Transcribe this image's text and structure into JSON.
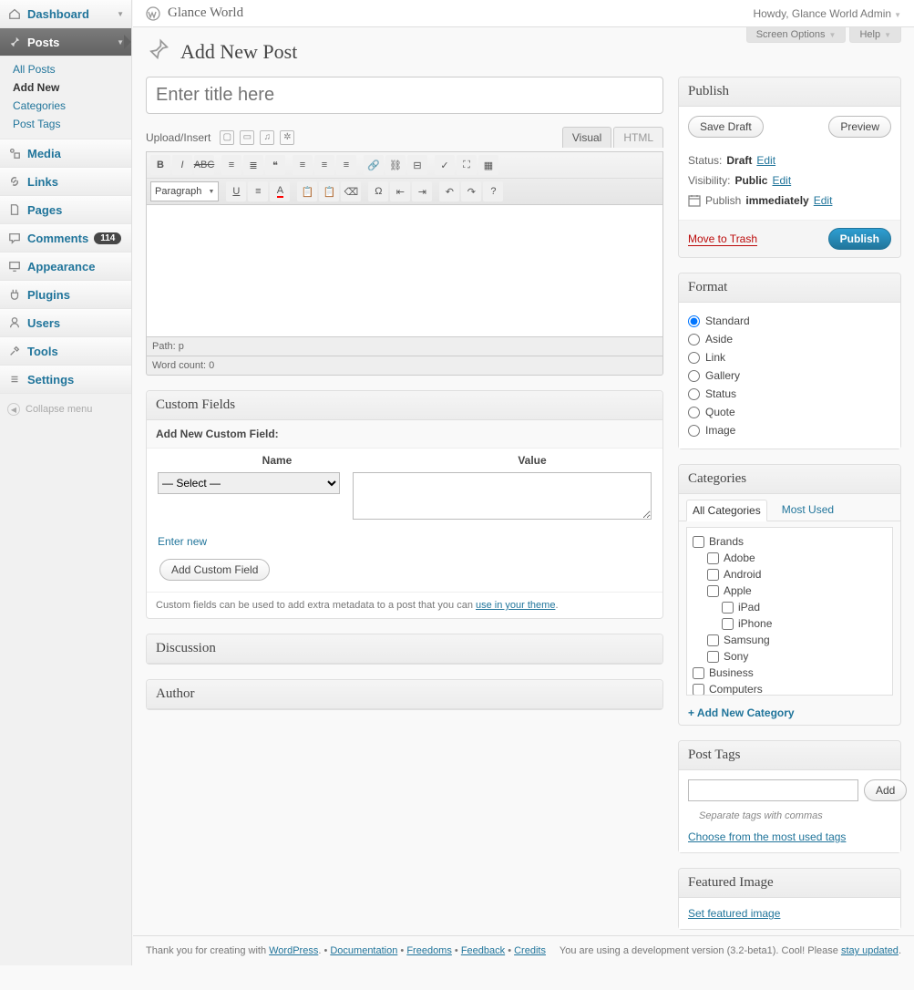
{
  "header": {
    "site_name": "Glance World",
    "howdy": "Howdy, Glance World Admin"
  },
  "screen_meta": {
    "screen_options": "Screen Options",
    "help": "Help"
  },
  "page_title": "Add New Post",
  "menu": {
    "dashboard": "Dashboard",
    "posts": "Posts",
    "media": "Media",
    "links": "Links",
    "pages": "Pages",
    "comments": "Comments",
    "comments_count": "114",
    "appearance": "Appearance",
    "plugins": "Plugins",
    "users": "Users",
    "tools": "Tools",
    "settings": "Settings",
    "collapse": "Collapse menu",
    "submenu": {
      "all_posts": "All Posts",
      "add_new": "Add New",
      "categories": "Categories",
      "post_tags": "Post Tags"
    }
  },
  "title_placeholder": "Enter title here",
  "upload_label": "Upload/Insert",
  "editor": {
    "tab_visual": "Visual",
    "tab_html": "HTML",
    "paragraph": "Paragraph",
    "path": "Path: p",
    "wordcount": "Word count: 0"
  },
  "custom_fields": {
    "title": "Custom Fields",
    "add_label": "Add New Custom Field:",
    "name": "Name",
    "value": "Value",
    "select": "— Select —",
    "enter_new": "Enter new",
    "button": "Add Custom Field",
    "note": "Custom fields can be used to add extra metadata to a post that you can ",
    "note_link": "use in your theme"
  },
  "discussion_title": "Discussion",
  "author_title": "Author",
  "publish": {
    "title": "Publish",
    "save_draft": "Save Draft",
    "preview": "Preview",
    "status_label": "Status:",
    "status_value": "Draft",
    "visibility_label": "Visibility:",
    "visibility_value": "Public",
    "publish_label": "Publish",
    "immediately": "immediately",
    "edit": "Edit",
    "trash": "Move to Trash",
    "publish_btn": "Publish"
  },
  "format": {
    "title": "Format",
    "options": [
      "Standard",
      "Aside",
      "Link",
      "Gallery",
      "Status",
      "Quote",
      "Image"
    ],
    "selected": "Standard"
  },
  "categories": {
    "title": "Categories",
    "tab_all": "All Categories",
    "tab_most": "Most Used",
    "add_new": "+ Add New Category",
    "list": [
      {
        "label": "Brands",
        "indent": 0
      },
      {
        "label": "Adobe",
        "indent": 1
      },
      {
        "label": "Android",
        "indent": 1
      },
      {
        "label": "Apple",
        "indent": 1
      },
      {
        "label": "iPad",
        "indent": 2
      },
      {
        "label": "iPhone",
        "indent": 2
      },
      {
        "label": "Samsung",
        "indent": 1
      },
      {
        "label": "Sony",
        "indent": 1
      },
      {
        "label": "Business",
        "indent": 0
      },
      {
        "label": "Computers",
        "indent": 0
      }
    ]
  },
  "tags": {
    "title": "Post Tags",
    "add": "Add",
    "hint": "Separate tags with commas",
    "most": "Choose from the most used tags"
  },
  "featured": {
    "title": "Featured Image",
    "link": "Set featured image"
  },
  "footer": {
    "left_pre": "Thank you for creating with ",
    "wordpress": "WordPress",
    "documentation": "Documentation",
    "freedoms": "Freedoms",
    "feedback": "Feedback",
    "credits": "Credits",
    "right_pre": "You are using a development version (3.2-beta1). Cool! Please ",
    "stay_updated": "stay updated"
  }
}
